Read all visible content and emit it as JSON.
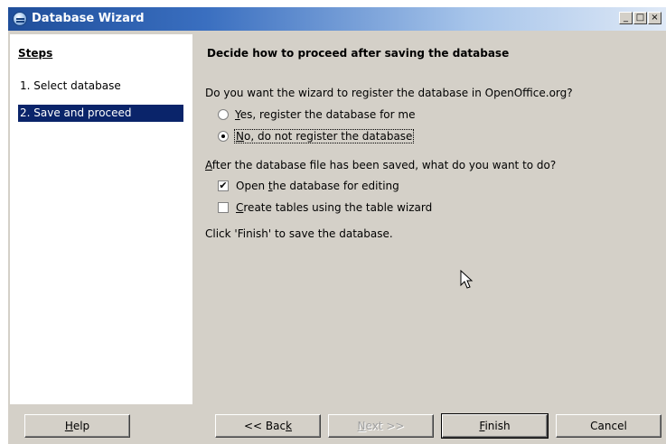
{
  "window": {
    "title": "Database Wizard",
    "controls": {
      "minimize": "_",
      "maximize": "□",
      "close": "×"
    }
  },
  "steps": {
    "heading": "Steps",
    "items": [
      {
        "label": "1. Select database",
        "selected": false
      },
      {
        "label": "2. Save and proceed",
        "selected": true
      }
    ]
  },
  "main": {
    "heading": "Decide how to proceed after saving the database",
    "register_question": "Do you want the wizard to register the database in OpenOffice.org?",
    "register_options": [
      {
        "label_accel": "Y",
        "label_rest": "es, register the database for me",
        "selected": false
      },
      {
        "label_accel": "N",
        "label_rest": "o, do not register the database",
        "selected": true
      }
    ],
    "after_question_accel": "A",
    "after_question_rest": "fter the database file has been saved, what do you want to do?",
    "after_options": [
      {
        "label_pre": "Open ",
        "label_accel": "t",
        "label_post": "he database for editing",
        "checked": true
      },
      {
        "label_pre": "",
        "label_accel": "C",
        "label_post": "reate tables using the table wizard",
        "checked": false
      }
    ],
    "finish_note": "Click 'Finish' to save the database."
  },
  "buttons": {
    "help": {
      "pre": "",
      "accel": "H",
      "post": "elp"
    },
    "back": {
      "pre": "<< Bac",
      "accel": "k",
      "post": ""
    },
    "next": {
      "pre": "",
      "accel": "N",
      "post": "ext >>",
      "enabled": false
    },
    "finish": {
      "pre": "",
      "accel": "F",
      "post": "inish"
    },
    "cancel": {
      "label": "Cancel"
    }
  }
}
